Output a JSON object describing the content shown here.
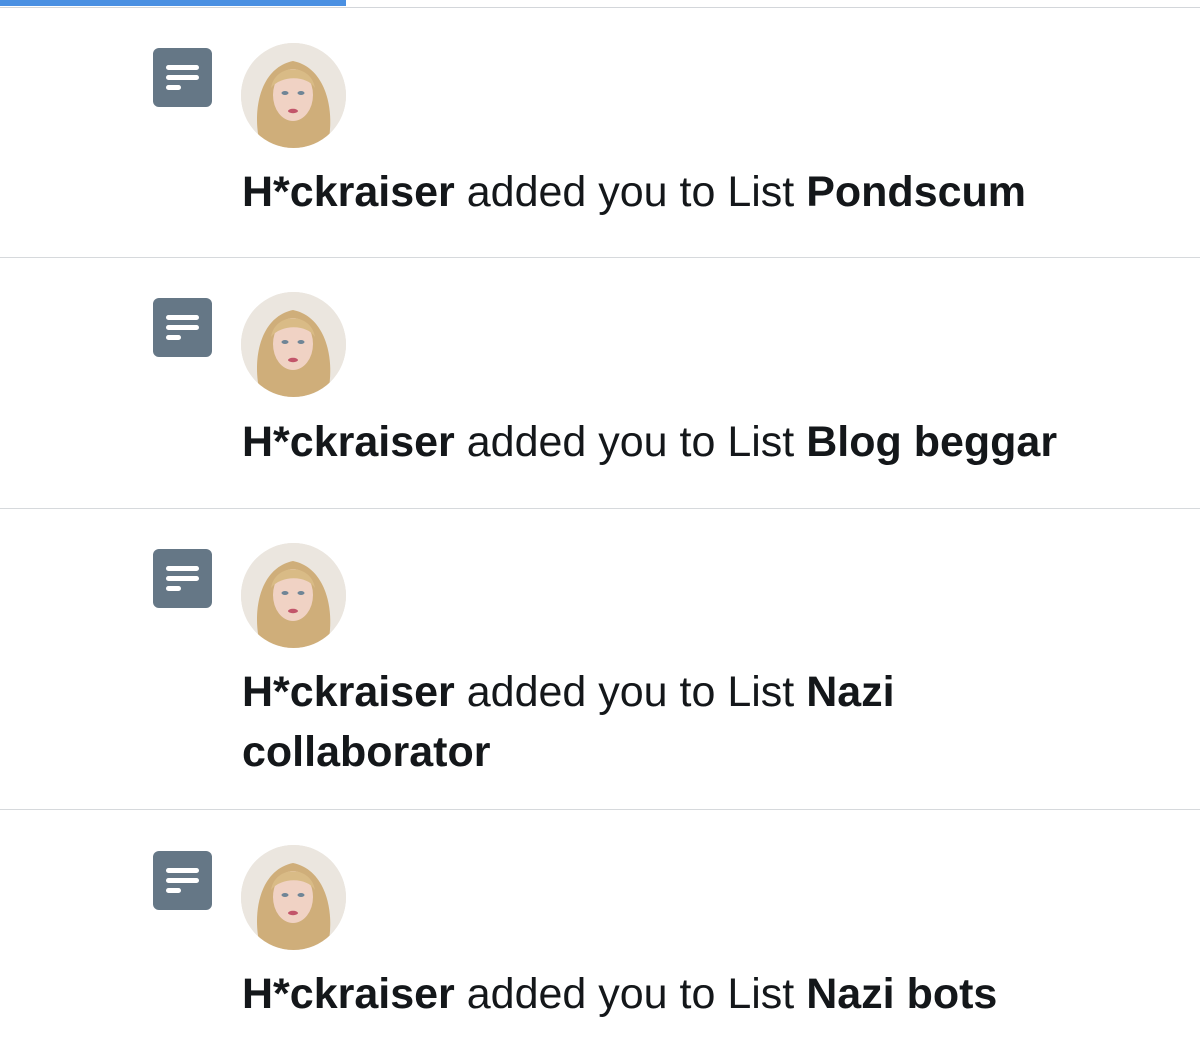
{
  "notifications": [
    {
      "user": "H*ckraiser",
      "action": "added you to List",
      "list_name": "Pondscum",
      "icon": "list-icon"
    },
    {
      "user": "H*ckraiser",
      "action": "added you to List",
      "list_name": "Blog beggar",
      "icon": "list-icon"
    },
    {
      "user": "H*ckraiser",
      "action": "added you to List",
      "list_name": "Nazi collaborator",
      "icon": "list-icon"
    },
    {
      "user": "H*ckraiser",
      "action": "added you to List",
      "list_name": "Nazi bots",
      "icon": "list-icon"
    }
  ],
  "colors": {
    "accent": "#4a90e2",
    "icon_bg": "#657786",
    "text": "#14171a",
    "divider": "#d6d9dc"
  }
}
